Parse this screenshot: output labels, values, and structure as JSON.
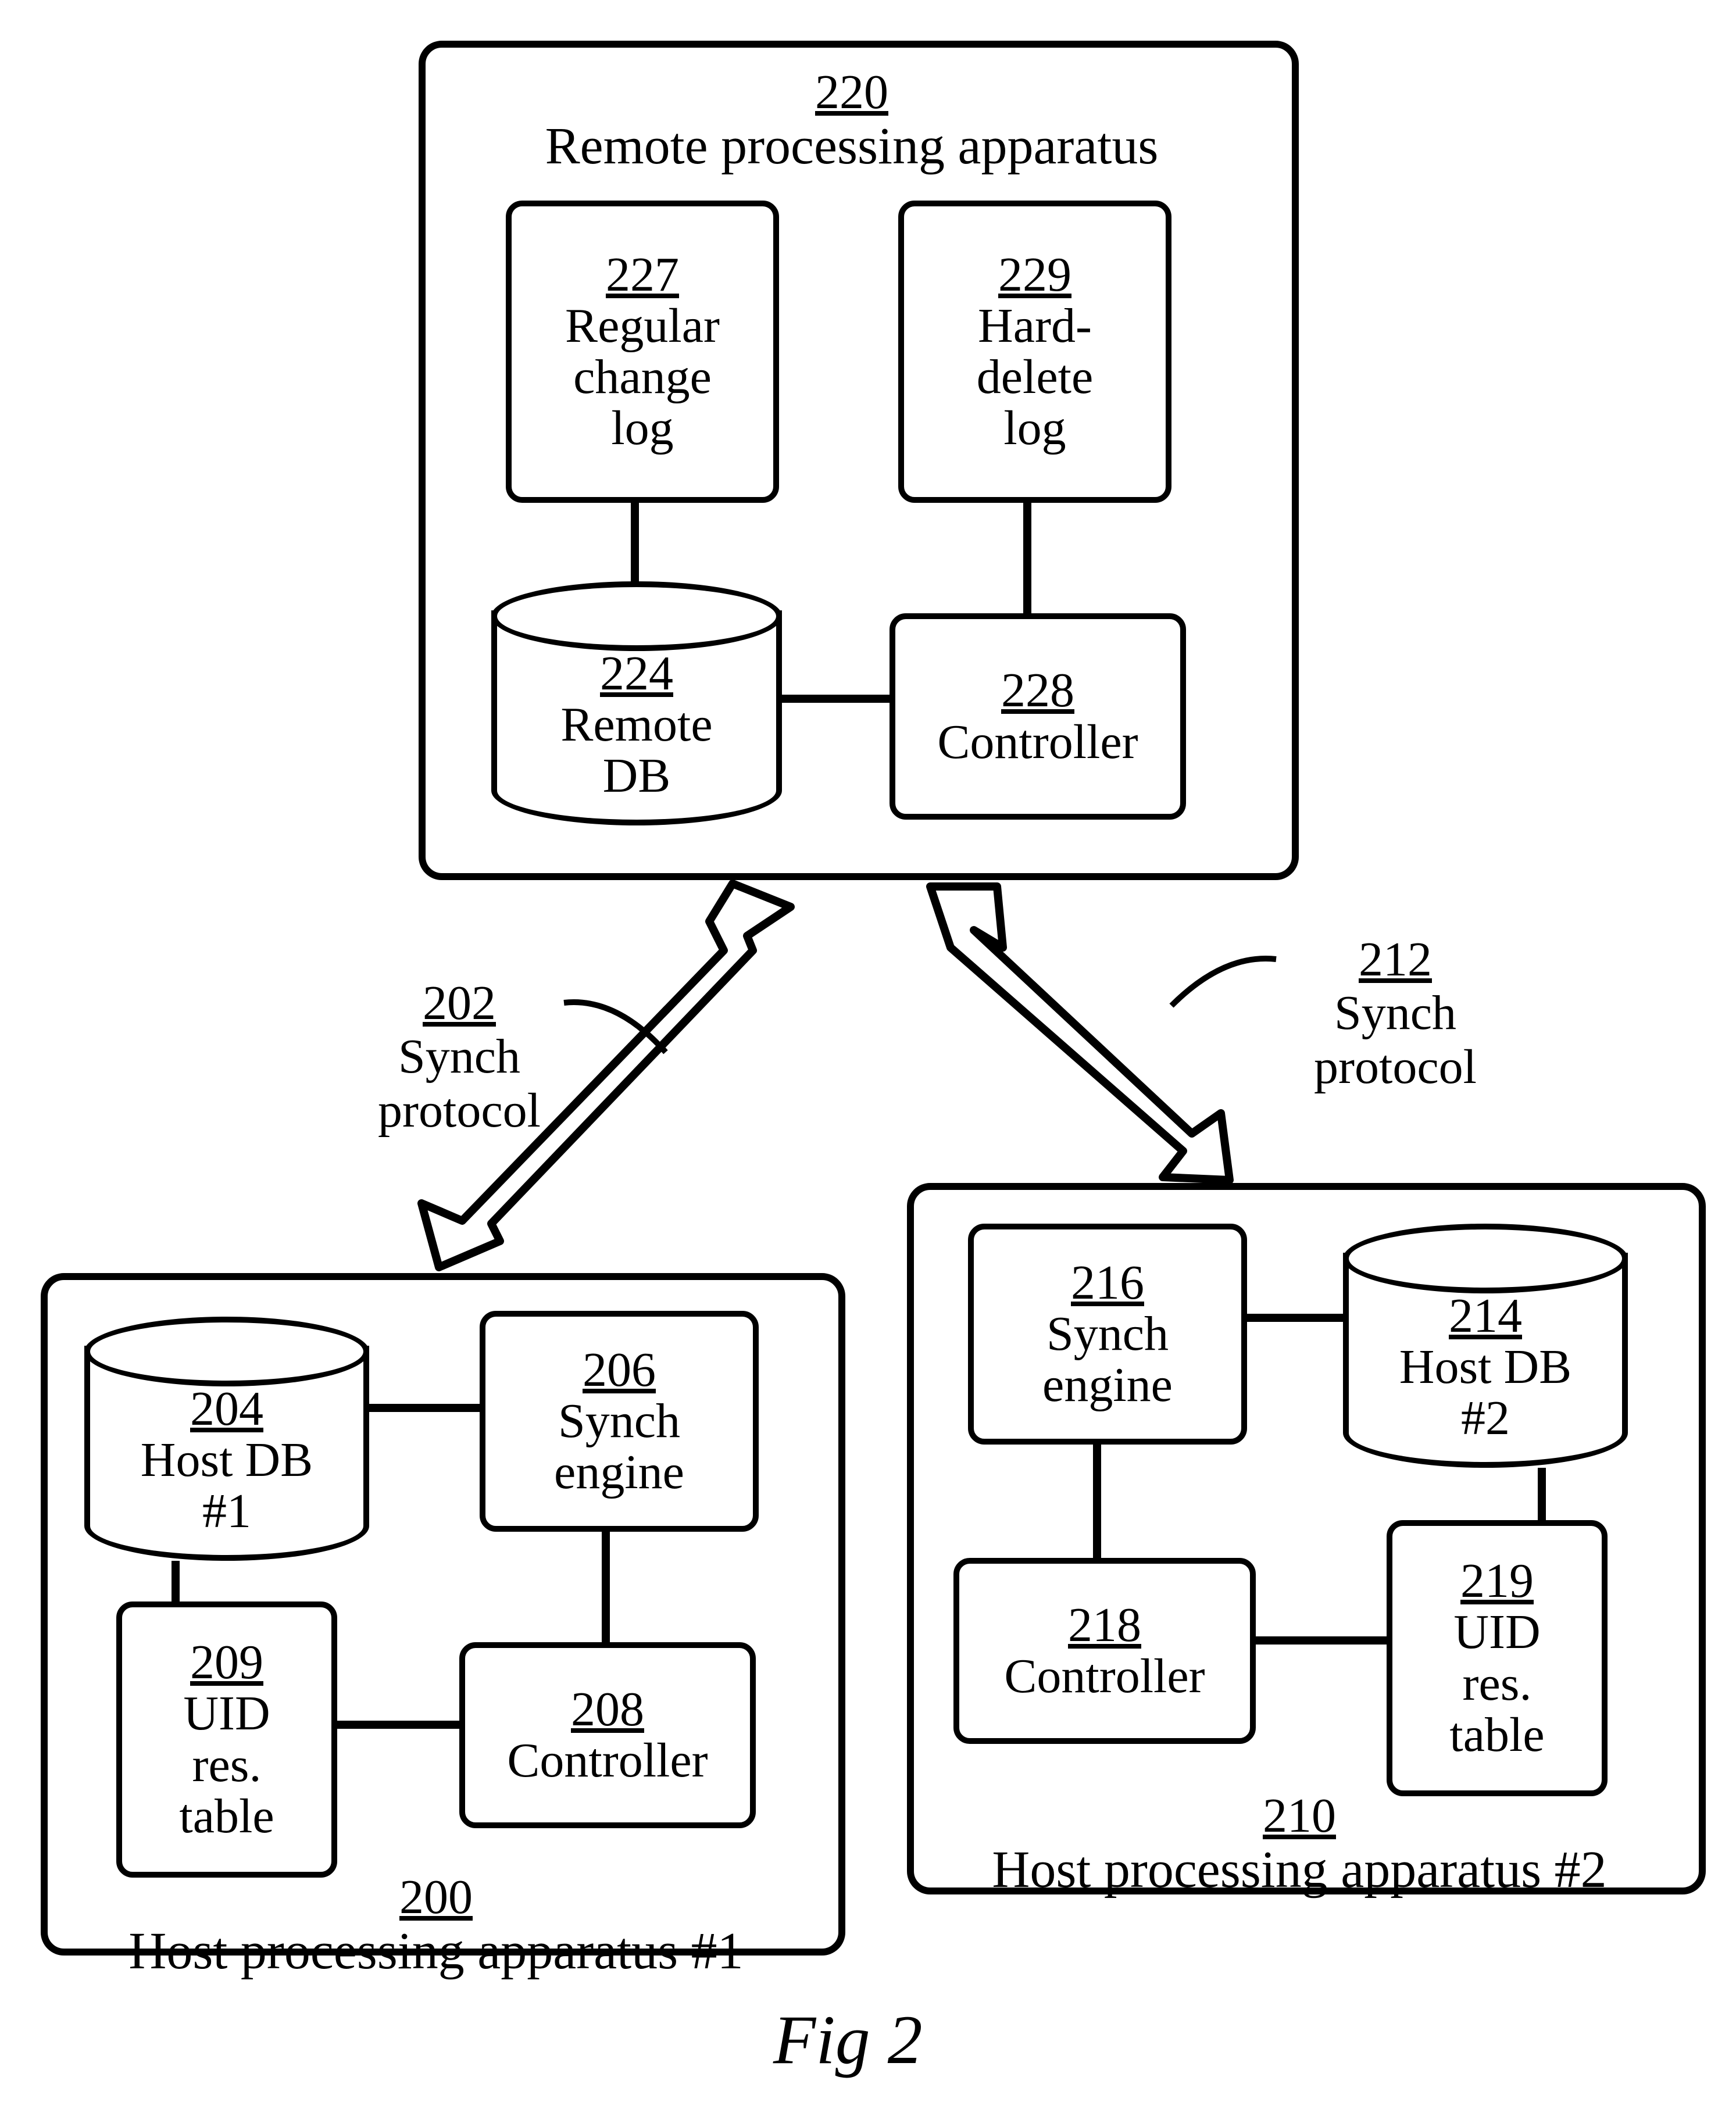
{
  "figure_caption": "Fig 2",
  "remote": {
    "ref": "220",
    "title": "Remote processing apparatus",
    "regular_log": {
      "ref": "227",
      "label": "Regular\nchange\nlog"
    },
    "hard_delete_log": {
      "ref": "229",
      "label": "Hard-\ndelete\nlog"
    },
    "db": {
      "ref": "224",
      "label": "Remote\nDB"
    },
    "controller": {
      "ref": "228",
      "label": "Controller"
    }
  },
  "proto_left": {
    "ref": "202",
    "label": "Synch\nprotocol"
  },
  "proto_right": {
    "ref": "212",
    "label": "Synch\nprotocol"
  },
  "host1": {
    "ref": "200",
    "title": "Host processing apparatus #1",
    "db": {
      "ref": "204",
      "label": "Host DB\n#1"
    },
    "synch": {
      "ref": "206",
      "label": "Synch\nengine"
    },
    "controller": {
      "ref": "208",
      "label": "Controller"
    },
    "uid": {
      "ref": "209",
      "label": "UID\nres.\ntable"
    }
  },
  "host2": {
    "ref": "210",
    "title": "Host processing apparatus #2",
    "synch": {
      "ref": "216",
      "label": "Synch\nengine"
    },
    "db": {
      "ref": "214",
      "label": "Host DB\n#2"
    },
    "controller": {
      "ref": "218",
      "label": "Controller"
    },
    "uid": {
      "ref": "219",
      "label": "UID\nres.\ntable"
    }
  }
}
